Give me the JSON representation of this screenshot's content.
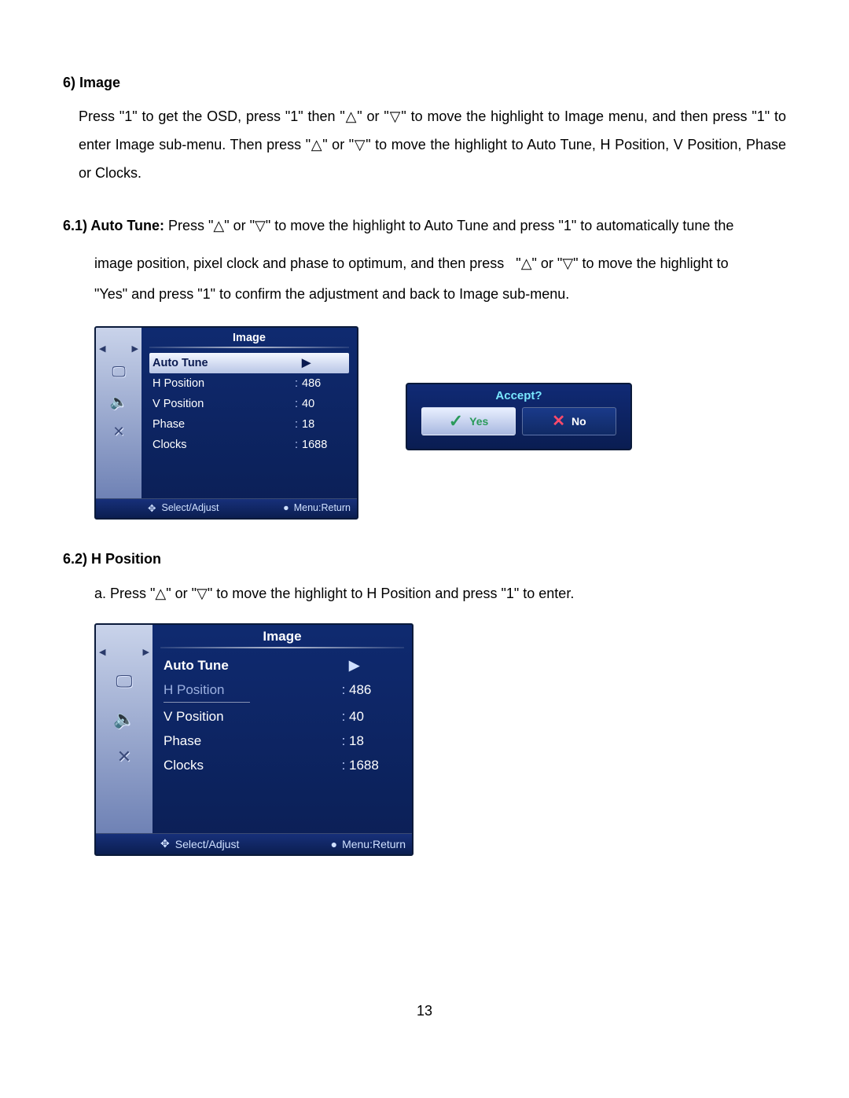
{
  "section6": {
    "heading": "6) Image",
    "body": "Press \"1\" to get the OSD, press \"1\" then \"△\" or \"▽\" to move the highlight to Image menu, and then press \"1\" to enter Image sub-menu. Then press \"△\" or \"▽\" to move the highlight to Auto Tune, H Position, V Position, Phase or Clocks."
  },
  "section61": {
    "lead_bold": "6.1) Auto Tune: ",
    "lead_rest": "Press \"△\" or \"▽\" to move the highlight to Auto Tune and press \"1\" to automatically tune the",
    "line2": "image position, pixel clock and phase to optimum, and then press   \"△\" or \"▽\" to move the highlight to",
    "line3": "\"Yes\" and press \"1\" to confirm the adjustment and back to Image sub-menu."
  },
  "osd1": {
    "title": "Image",
    "rows": [
      {
        "label": "Auto Tune",
        "value": "",
        "highlight": true,
        "arrow": true
      },
      {
        "label": "H Position",
        "value": "486"
      },
      {
        "label": "V Position",
        "value": "40"
      },
      {
        "label": "Phase",
        "value": "18"
      },
      {
        "label": "Clocks",
        "value": "1688"
      }
    ],
    "footer_left": "Select/Adjust",
    "footer_right": "Menu:Return"
  },
  "accept": {
    "title": "Accept?",
    "yes": "Yes",
    "no": "No"
  },
  "section62": {
    "heading": "6.2) H Position",
    "body": "a. Press \"△\" or \"▽\" to move the highlight to H Position and press \"1\" to enter."
  },
  "osd2": {
    "title": "Image",
    "rows": [
      {
        "label": "Auto Tune",
        "value": "",
        "arrow": true,
        "bold": true
      },
      {
        "label": "H Position",
        "value": "486",
        "underline": true
      },
      {
        "label": "V Position",
        "value": "40"
      },
      {
        "label": "Phase",
        "value": "18"
      },
      {
        "label": "Clocks",
        "value": "1688"
      }
    ],
    "footer_left": "Select/Adjust",
    "footer_right": "Menu:Return"
  },
  "icons": {
    "monitor": "🖵",
    "speaker": "🔈",
    "tools": "✕"
  },
  "page_number": "13"
}
